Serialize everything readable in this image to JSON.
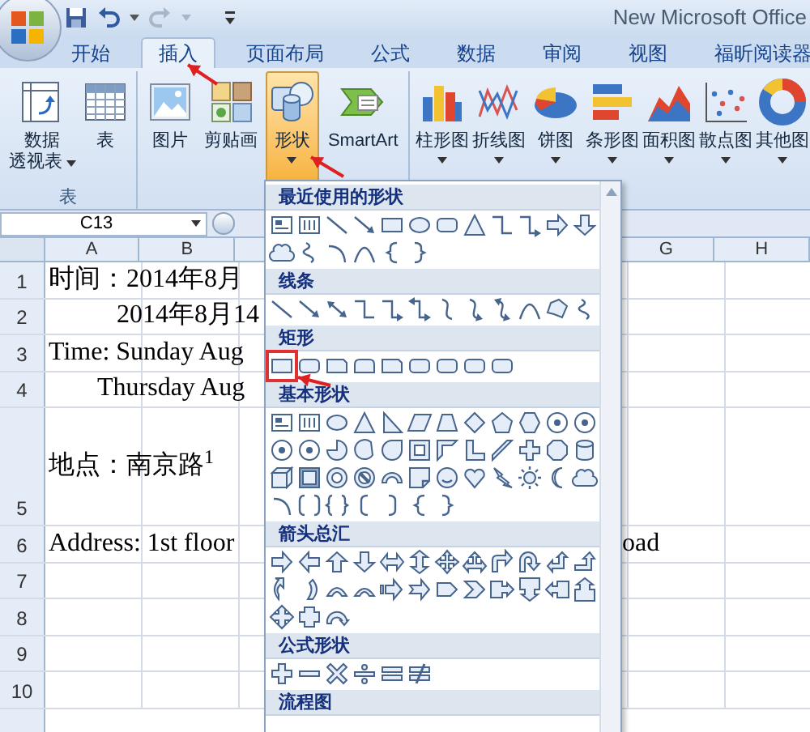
{
  "window": {
    "title": "New Microsoft Office"
  },
  "ribbon_tabs": [
    {
      "label": "开始",
      "selected": false
    },
    {
      "label": "插入",
      "selected": true
    },
    {
      "label": "页面布局",
      "selected": false
    },
    {
      "label": "公式",
      "selected": false
    },
    {
      "label": "数据",
      "selected": false
    },
    {
      "label": "审阅",
      "selected": false
    },
    {
      "label": "视图",
      "selected": false
    },
    {
      "label": "福昕阅读器",
      "selected": false
    }
  ],
  "table_group": {
    "label": "表",
    "buttons": [
      {
        "kind": "pivot-table",
        "lines": [
          "数据",
          "透视表"
        ],
        "dropdown": true,
        "selected": false
      },
      {
        "kind": "table",
        "lines": [
          "表"
        ],
        "dropdown": false,
        "selected": false
      }
    ]
  },
  "illustrations_group": {
    "buttons": [
      {
        "kind": "picture",
        "lines": [
          "图片"
        ],
        "dropdown": false,
        "selected": false
      },
      {
        "kind": "clip-art",
        "lines": [
          "剪贴画"
        ],
        "dropdown": false,
        "selected": false
      },
      {
        "kind": "shapes",
        "lines": [
          "形状"
        ],
        "dropdown": true,
        "selected": true
      },
      {
        "kind": "smartart",
        "lines": [
          "SmartArt"
        ],
        "dropdown": false,
        "selected": false
      }
    ]
  },
  "charts_group": {
    "buttons": [
      {
        "kind": "column-chart",
        "lines": [
          "柱形图"
        ],
        "dropdown": true,
        "selected": false
      },
      {
        "kind": "line-chart",
        "lines": [
          "折线图"
        ],
        "dropdown": true,
        "selected": false
      },
      {
        "kind": "pie-chart",
        "lines": [
          "饼图"
        ],
        "dropdown": true,
        "selected": false
      },
      {
        "kind": "bar-chart",
        "lines": [
          "条形图"
        ],
        "dropdown": true,
        "selected": false
      },
      {
        "kind": "area-chart",
        "lines": [
          "面积图"
        ],
        "dropdown": true,
        "selected": false
      },
      {
        "kind": "scatter-chart",
        "lines": [
          "散点图"
        ],
        "dropdown": true,
        "selected": false
      },
      {
        "kind": "donut-chart",
        "lines": [
          "其他图"
        ],
        "dropdown": true,
        "selected": false
      }
    ]
  },
  "name_box": {
    "value": "C13"
  },
  "columns": [
    {
      "label": "A"
    },
    {
      "label": "B"
    },
    {
      "label": "G"
    },
    {
      "label": "H"
    }
  ],
  "rows": [
    {
      "number": "1",
      "text": "时间：2014年8月",
      "indent": false,
      "tall": false
    },
    {
      "number": "2",
      "text": "2014年8月14",
      "indent": true,
      "tall": false
    },
    {
      "number": "3",
      "text": "Time: Sunday Aug",
      "indent": false,
      "tall": false
    },
    {
      "number": "4",
      "text": "Thursday Aug",
      "indent": true,
      "tall": false
    },
    {
      "number": "5",
      "text": "地点：南京路$^{1}$",
      "indent": false,
      "tall": true
    },
    {
      "number": "6",
      "text": "Address: 1st floor",
      "indent": false,
      "tall": false,
      "spill_text": "oad"
    },
    {
      "number": "7",
      "tall": false
    },
    {
      "number": "8",
      "tall": false
    },
    {
      "number": "9",
      "tall": false
    },
    {
      "number": "10",
      "tall": false
    }
  ],
  "shape_gallery": {
    "sections": [
      {
        "title": "最近使用的形状"
      },
      {
        "title": "线条"
      },
      {
        "title": "矩形"
      },
      {
        "title": "基本形状"
      },
      {
        "title": "箭头总汇"
      },
      {
        "title": "公式形状"
      },
      {
        "title": "流程图"
      }
    ]
  }
}
